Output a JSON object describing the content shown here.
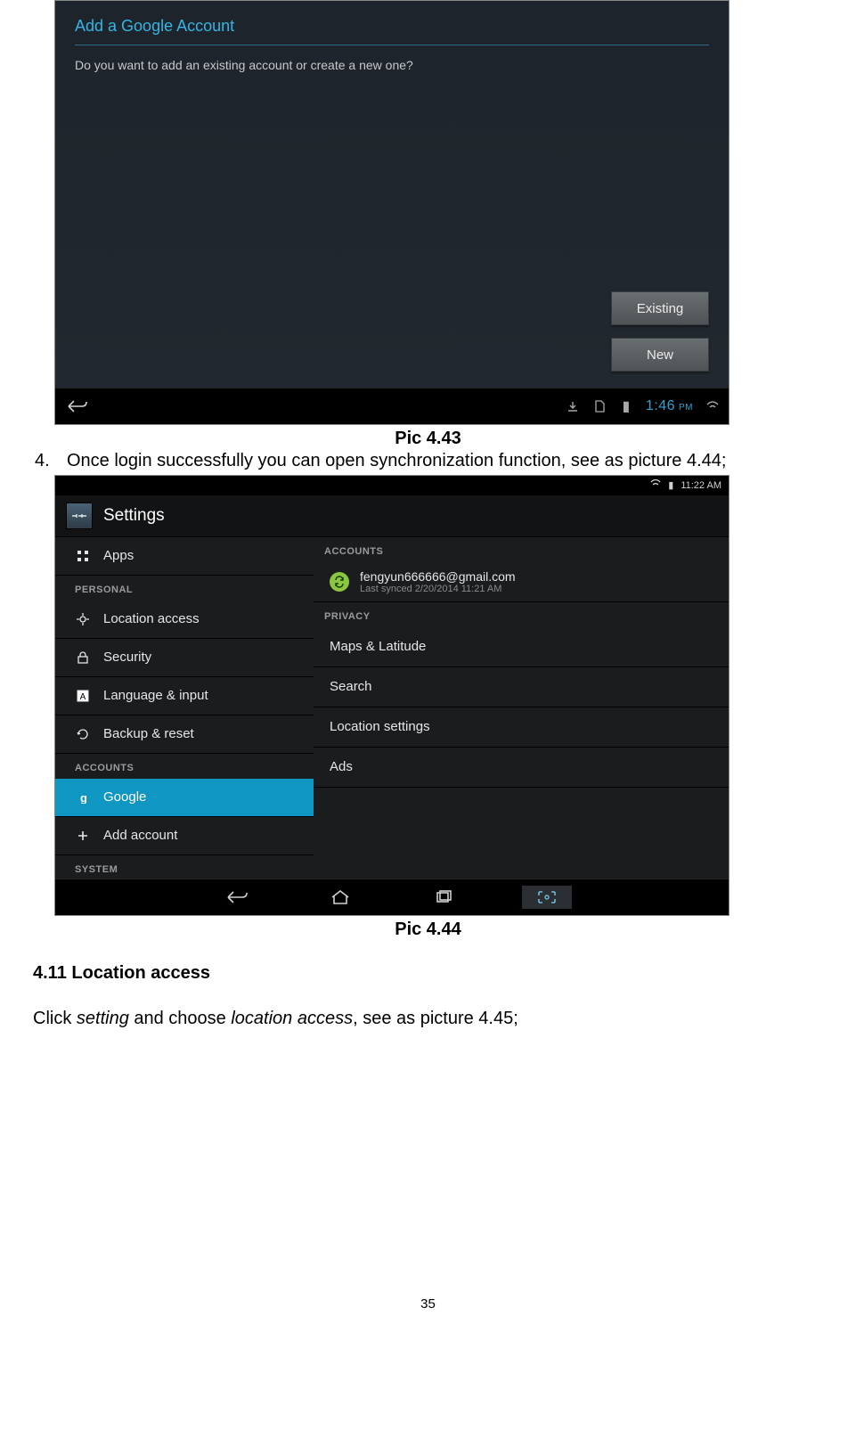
{
  "shot1": {
    "title": "Add a Google Account",
    "question": "Do you want to add an existing account or create a new one?",
    "buttons": {
      "existing": "Existing",
      "new": "New"
    },
    "clock": {
      "time": "1:46",
      "ampm": "PM"
    },
    "battery_icon": "▮"
  },
  "captions": {
    "p1": "Pic 4.43",
    "p2": "Pic 4.44"
  },
  "step4": {
    "num": "4.",
    "text": "Once login successfully you can open synchronization function, see as picture 4.44;"
  },
  "shot2": {
    "status_time": "11:22 AM",
    "header": "Settings",
    "left": {
      "apps": "Apps",
      "personal_hdr": "PERSONAL",
      "location": "Location access",
      "security": "Security",
      "language": "Language & input",
      "backup": "Backup & reset",
      "accounts_hdr": "ACCOUNTS",
      "google": "Google",
      "add": "Add account",
      "system_hdr": "SYSTEM"
    },
    "right": {
      "accounts_hdr": "ACCOUNTS",
      "email": "fengyun666666@gmail.com",
      "synced": "Last synced 2/20/2014 11:21 AM",
      "privacy_hdr": "PRIVACY",
      "maps": "Maps & Latitude",
      "search": "Search",
      "location": "Location settings",
      "ads": "Ads"
    }
  },
  "section": {
    "head": "4.11 Location access",
    "body_pre": "Click ",
    "body_em1": "setting",
    "body_mid": " and choose ",
    "body_em2": "location access",
    "body_post": ", see as picture 4.45;"
  },
  "page_number": "35"
}
